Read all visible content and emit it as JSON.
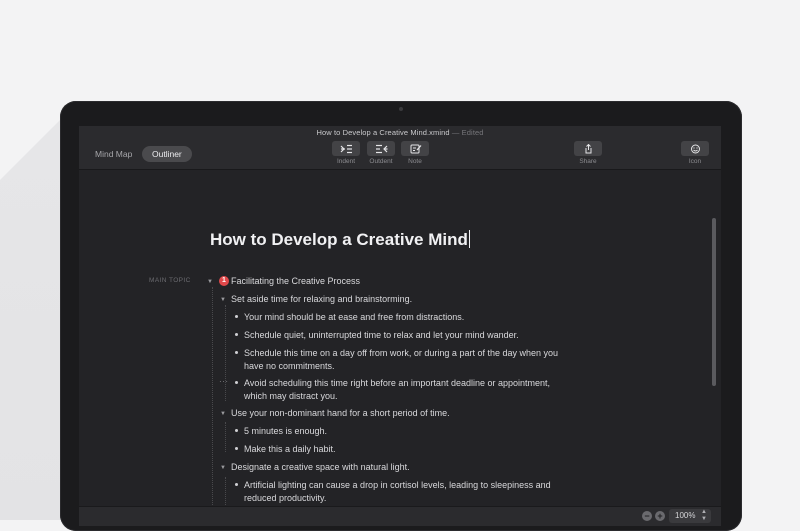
{
  "window": {
    "doc_title": "How to Develop a Creative Mind.xmind",
    "doc_status": "— Edited"
  },
  "toolbar": {
    "view_mindmap": "Mind Map",
    "view_outliner": "Outliner",
    "indent_label": "Indent",
    "outdent_label": "Outdent",
    "note_label": "Note",
    "share_label": "Share",
    "icon_label": "Icon"
  },
  "outline": {
    "title": "How to Develop a Creative Mind",
    "main_topic_label": "MAIN TOPIC",
    "priority_marker": "1",
    "main_topic": "Facilitating the Creative Process",
    "sub1": "Set aside time for relaxing and brainstorming.",
    "sub1_items": [
      "Your mind should be at ease and free from distractions.",
      "Schedule quiet, uninterrupted time to relax and let your mind wander.",
      "Schedule this time on a day off from work, or during a part of the day when you",
      "have no commitments.",
      "Avoid scheduling this time right before an important deadline or appointment,",
      "which may distract you."
    ],
    "sub2": "Use your non-dominant hand for a short period of time.",
    "sub2_items": [
      "5 minutes is enough.",
      "Make this a daily habit."
    ],
    "sub3": "Designate a creative space with natural light.",
    "sub3_items": [
      "Artificial lighting can cause a drop in cortisol levels, leading to sleepiness and",
      "reduced productivity."
    ]
  },
  "statusbar": {
    "zoom": "100%"
  },
  "colors": {
    "priority": "#e0484a",
    "background": "#232326",
    "toolbar": "#2b2b2e"
  }
}
